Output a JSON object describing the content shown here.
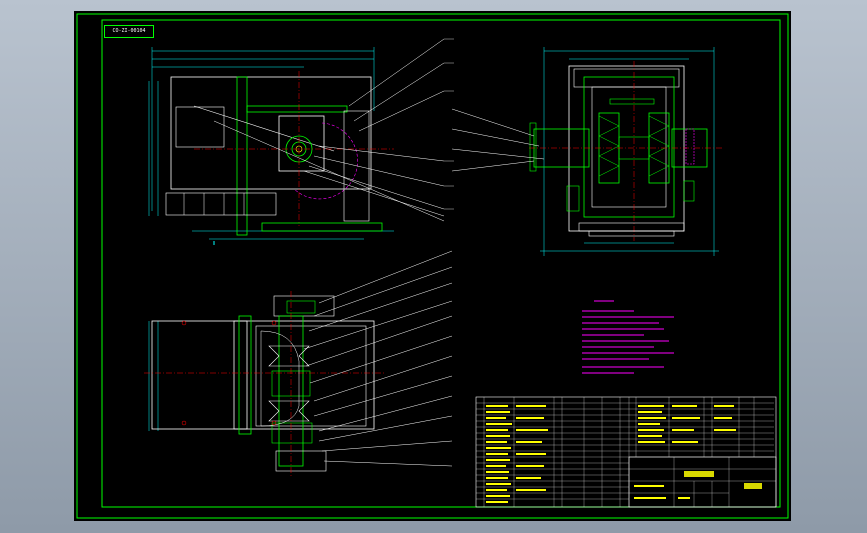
{
  "drawing": {
    "drawing_number": "CO-ZI-00104",
    "colors": {
      "background": "#000000",
      "frame": "#00ff00",
      "outline": "#ffffff",
      "centerline": "#ff0000",
      "dimension": "#00ffff",
      "hidden": "#ff00ff",
      "parts": "#ffff00"
    },
    "views": [
      "front-view",
      "right-side-view",
      "top-view",
      "technical-requirements",
      "parts-list",
      "title-block"
    ]
  }
}
